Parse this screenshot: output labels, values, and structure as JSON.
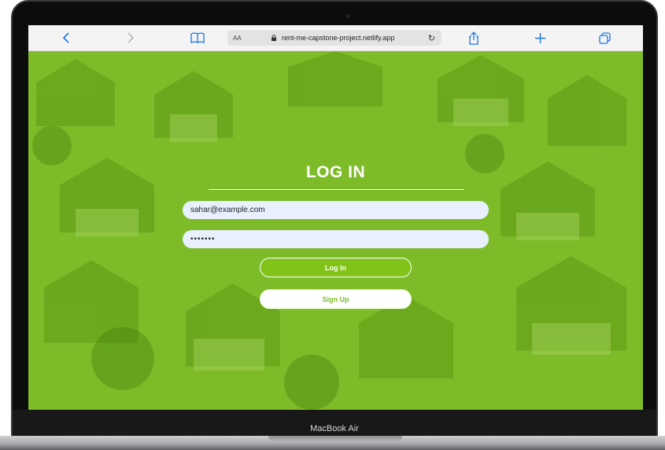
{
  "browser": {
    "text_size_label": "AA",
    "url": "rent-me-capstone-project.netlify.app",
    "icons": [
      "chevron-left-icon",
      "chevron-right-icon",
      "book-icon",
      "lock-icon",
      "reload-icon",
      "share-icon",
      "plus-icon",
      "tabs-icon"
    ],
    "accent_color": "#1a73e8"
  },
  "login": {
    "title": "LOG IN",
    "email_value": "sahar@example.com",
    "password_value": "•••••••",
    "login_button": "Log In",
    "signup_button": "Sign Up",
    "brand_color": "#7cbb25"
  },
  "device": {
    "label": "MacBook Air"
  }
}
